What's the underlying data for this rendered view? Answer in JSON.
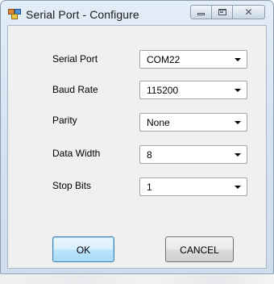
{
  "window": {
    "title": "Serial Port - Configure",
    "app_icon": "serial-port-app-icon",
    "caption_icons": [
      "minimize-icon",
      "maximize-icon",
      "close-icon"
    ],
    "close_glyph": "✕"
  },
  "form": {
    "fields": [
      {
        "label": "Serial Port",
        "value": "COM22"
      },
      {
        "label": "Baud Rate",
        "value": "115200"
      },
      {
        "label": "Parity",
        "value": "None"
      },
      {
        "label": "Data Width",
        "value": "8"
      },
      {
        "label": "Stop Bits",
        "value": "1"
      }
    ]
  },
  "buttons": {
    "ok": "OK",
    "cancel": "CANCEL"
  },
  "colors": {
    "default_button_border": "#3c7fb1",
    "client_background": "#f0f0f0"
  }
}
